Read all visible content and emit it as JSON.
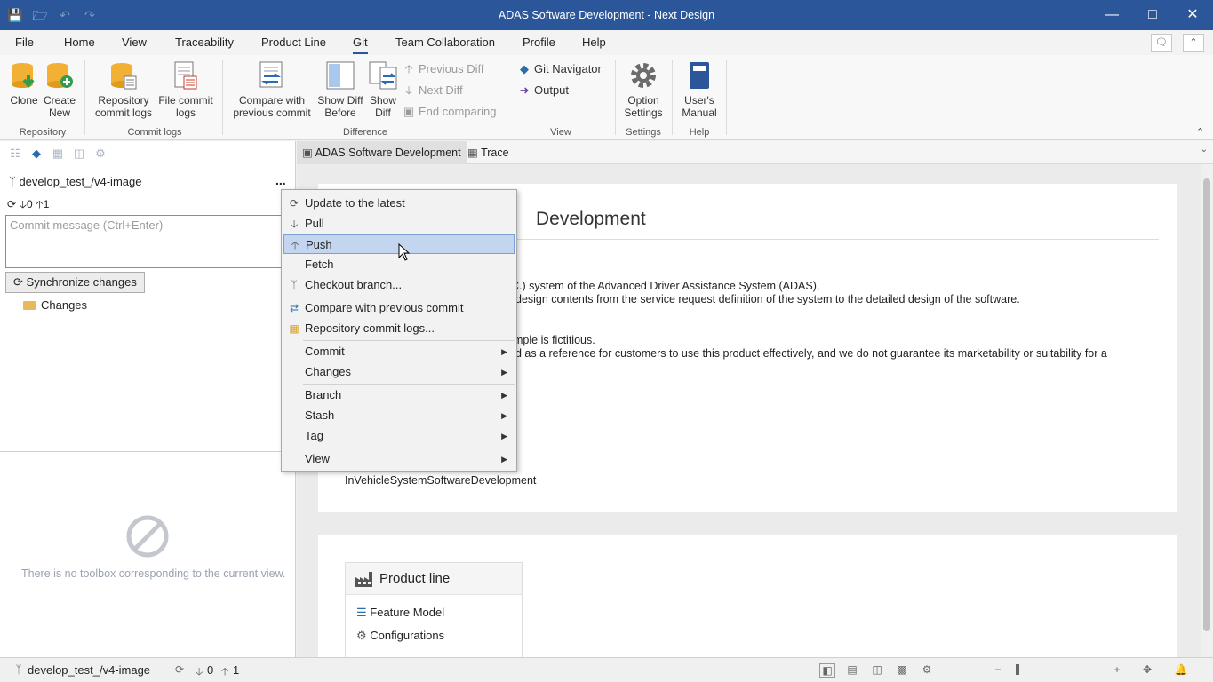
{
  "window": {
    "title": "ADAS Software Development - Next Design"
  },
  "menu": {
    "tabs": [
      "File",
      "Home",
      "View",
      "Traceability",
      "Product Line",
      "Git",
      "Team Collaboration",
      "Profile",
      "Help"
    ],
    "active": "Git"
  },
  "ribbon": {
    "clone": "Clone",
    "create_new_1": "Create",
    "create_new_2": "New",
    "repo_logs_1": "Repository",
    "repo_logs_2": "commit logs",
    "file_logs_1": "File commit",
    "file_logs_2": "logs",
    "compare_1": "Compare with",
    "compare_2": "previous commit",
    "show_diff_before_1": "Show Diff",
    "show_diff_before_2": "Before",
    "show_diff_1": "Show",
    "show_diff_2": "Diff",
    "previous_diff": "Previous Diff",
    "next_diff": "Next Diff",
    "end_comparing": "End comparing",
    "git_navigator": "Git Navigator",
    "output": "Output",
    "option_settings_1": "Option",
    "option_settings_2": "Settings",
    "users_manual_1": "User's",
    "users_manual_2": "Manual",
    "groups": {
      "repository": "Repository",
      "commit_logs": "Commit logs",
      "difference": "Difference",
      "view": "View",
      "settings": "Settings",
      "help": "Help"
    }
  },
  "left_panel": {
    "branch": "develop_test_/v4-image",
    "more": "...",
    "incoming": "0",
    "outgoing": "1",
    "commit_placeholder": "Commit message (Ctrl+Enter)",
    "sync_button": "Synchronize changes",
    "changes": "Changes",
    "no_toolbox": "There is no toolbox corresponding to the current view."
  },
  "doc": {
    "tabs": [
      "ADAS Software Development",
      "Trace"
    ],
    "title_fragment": "Development",
    "lines": [
      "C.) system of the Advanced Driver Assistance System (ADAS),",
      "design contents from the service request definition of the system to the detailed design of the software.",
      "mple is fictitious.",
      "d as a reference for customers to use this product effectively, and we do not guarantee its marketability or suitability for a"
    ],
    "identifier": "InVehicleSystemSoftwareDevelopment",
    "product_line": {
      "title": "Product line",
      "items": [
        "Feature Model",
        "Configurations"
      ]
    }
  },
  "context_menu": {
    "items": [
      {
        "label": "Update to the latest",
        "icon": "refresh-icon"
      },
      {
        "label": "Pull",
        "icon": "arrow-down-icon"
      },
      {
        "label": "Push",
        "icon": "arrow-up-icon",
        "highlighted": true
      },
      {
        "label": "Fetch",
        "icon": ""
      },
      {
        "label": "Checkout branch...",
        "icon": "branch-icon"
      },
      {
        "label": "Compare with previous commit",
        "icon": "compare-icon"
      },
      {
        "label": "Repository commit logs...",
        "icon": "repo-logs-icon"
      },
      {
        "label": "Commit",
        "submenu": true
      },
      {
        "label": "Changes",
        "submenu": true
      },
      {
        "label": "Branch",
        "submenu": true
      },
      {
        "label": "Stash",
        "submenu": true
      },
      {
        "label": "Tag",
        "submenu": true
      },
      {
        "label": "View",
        "submenu": true
      }
    ]
  },
  "status_bar": {
    "branch": "develop_test_/v4-image",
    "incoming": "0",
    "outgoing": "1"
  },
  "colors": {
    "titlebar": "#2b579a",
    "highlight": "#c4d5f0"
  }
}
